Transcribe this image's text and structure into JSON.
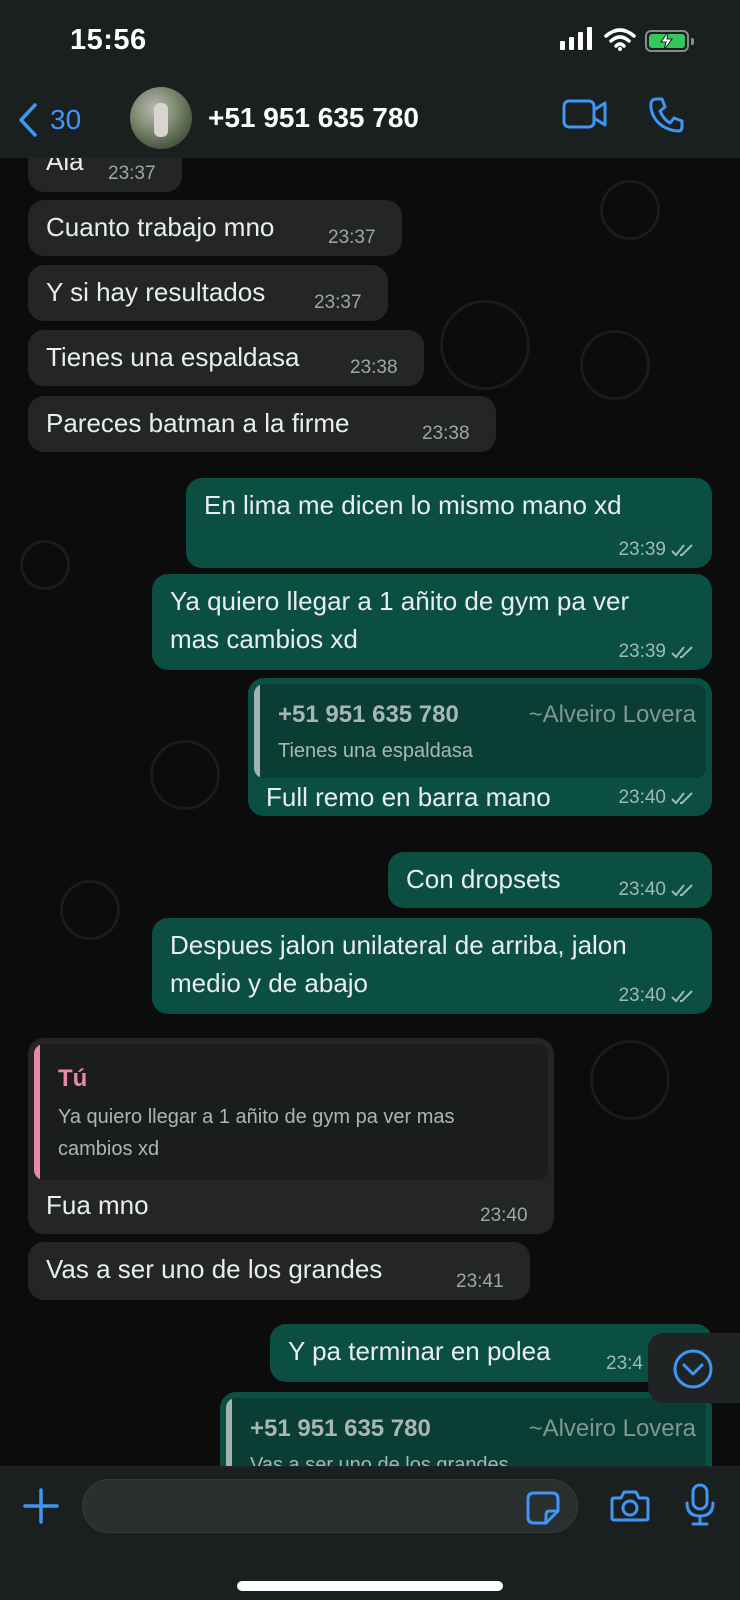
{
  "status": {
    "time": "15:56"
  },
  "header": {
    "back_count": "30",
    "contact": "+51 951 635 780"
  },
  "messages": [
    {
      "dir": "in",
      "text": "Ala",
      "time": "23:37"
    },
    {
      "dir": "in",
      "text": "Cuanto trabajo mno",
      "time": "23:37"
    },
    {
      "dir": "in",
      "text": "Y si hay resultados",
      "time": "23:37"
    },
    {
      "dir": "in",
      "text": "Tienes una espaldasa",
      "time": "23:38"
    },
    {
      "dir": "in",
      "text": "Pareces batman a la firme",
      "time": "23:38"
    },
    {
      "dir": "out",
      "text": "En lima me dicen lo mismo mano xd",
      "time": "23:39"
    },
    {
      "dir": "out",
      "text_line1": "Ya quiero llegar a 1 añito de gym pa ver",
      "text_line2": "mas cambios xd",
      "time": "23:39"
    },
    {
      "dir": "out",
      "quote": {
        "name": "+51 951 635 780",
        "alias": "~Alveiro Lovera",
        "text": "Tienes una espaldasa"
      },
      "text": "Full remo en barra mano",
      "time": "23:40"
    },
    {
      "dir": "out",
      "text": "Con dropsets",
      "time": "23:40"
    },
    {
      "dir": "out",
      "text_line1": "Despues jalon unilateral de arriba, jalon",
      "text_line2": "medio y de abajo",
      "time": "23:40"
    },
    {
      "dir": "in",
      "quote": {
        "name": "Tú",
        "text_line1": "Ya quiero llegar a 1 añito de gym pa ver mas",
        "text_line2": "cambios xd"
      },
      "text": "Fua mno",
      "time": "23:40"
    },
    {
      "dir": "in",
      "text": "Vas a ser uno de los grandes",
      "time": "23:41"
    },
    {
      "dir": "out",
      "text": "Y pa terminar en polea",
      "time": "23:4"
    },
    {
      "dir": "out",
      "quote": {
        "name": "+51 951 635 780",
        "alias": "~Alveiro Lovera",
        "text": "Vas a ser uno de los grandes"
      }
    }
  ],
  "input": {
    "placeholder": ""
  },
  "colors": {
    "accent": "#3e97f5",
    "outgoing": "#0b4f43",
    "incoming": "#242626",
    "quote_self": "#e68aa6"
  }
}
